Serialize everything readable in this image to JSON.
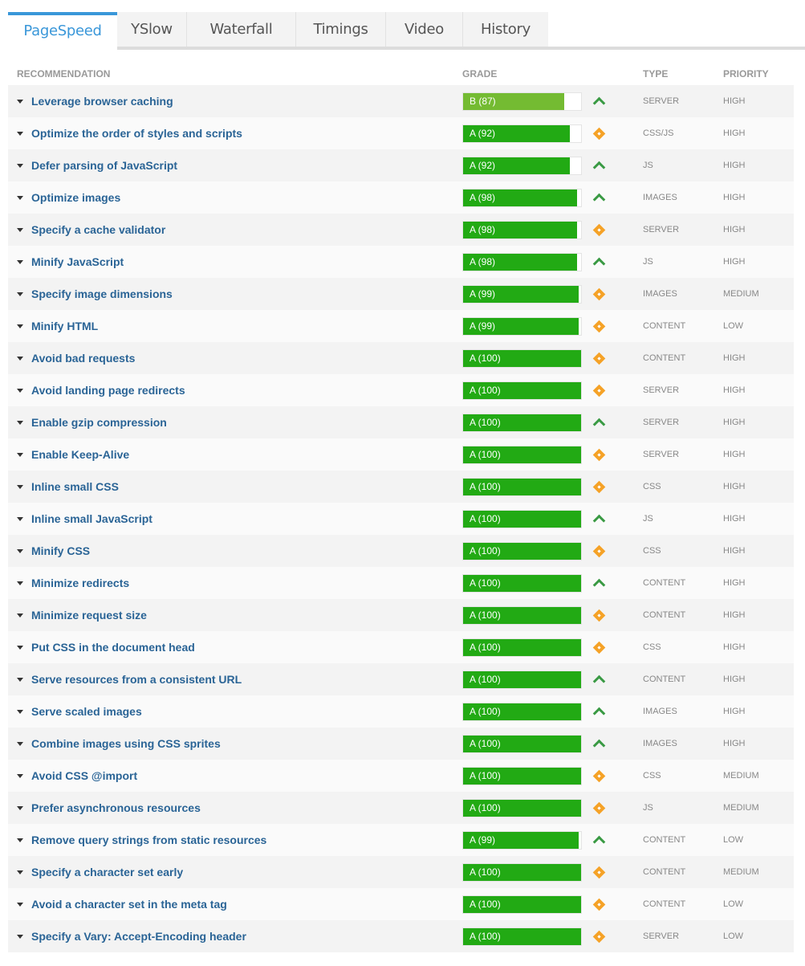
{
  "tabs": [
    {
      "label": "PageSpeed",
      "active": true
    },
    {
      "label": "YSlow",
      "active": false
    },
    {
      "label": "Waterfall",
      "active": false
    },
    {
      "label": "Timings",
      "active": false
    },
    {
      "label": "Video",
      "active": false
    },
    {
      "label": "History",
      "active": false
    }
  ],
  "colors": {
    "accent": "#3a97d9",
    "grade_a": "#22aa14",
    "grade_b": "#74bb32",
    "trend_up": "#3a9a44",
    "trend_neutral": "#f5a227",
    "link": "#2a6496"
  },
  "table": {
    "headers": {
      "recommendation": "RECOMMENDATION",
      "grade": "GRADE",
      "type": "TYPE",
      "priority": "PRIORITY"
    },
    "rows": [
      {
        "name": "Leverage browser caching",
        "grade": "B",
        "score": 87,
        "grade_label": "B (87)",
        "trend": "up",
        "type": "SERVER",
        "priority": "HIGH"
      },
      {
        "name": "Optimize the order of styles and scripts",
        "grade": "A",
        "score": 92,
        "grade_label": "A (92)",
        "trend": "neutral",
        "type": "CSS/JS",
        "priority": "HIGH"
      },
      {
        "name": "Defer parsing of JavaScript",
        "grade": "A",
        "score": 92,
        "grade_label": "A (92)",
        "trend": "up",
        "type": "JS",
        "priority": "HIGH"
      },
      {
        "name": "Optimize images",
        "grade": "A",
        "score": 98,
        "grade_label": "A (98)",
        "trend": "up",
        "type": "IMAGES",
        "priority": "HIGH"
      },
      {
        "name": "Specify a cache validator",
        "grade": "A",
        "score": 98,
        "grade_label": "A (98)",
        "trend": "neutral",
        "type": "SERVER",
        "priority": "HIGH"
      },
      {
        "name": "Minify JavaScript",
        "grade": "A",
        "score": 98,
        "grade_label": "A (98)",
        "trend": "up",
        "type": "JS",
        "priority": "HIGH"
      },
      {
        "name": "Specify image dimensions",
        "grade": "A",
        "score": 99,
        "grade_label": "A (99)",
        "trend": "neutral",
        "type": "IMAGES",
        "priority": "MEDIUM"
      },
      {
        "name": "Minify HTML",
        "grade": "A",
        "score": 99,
        "grade_label": "A (99)",
        "trend": "neutral",
        "type": "CONTENT",
        "priority": "LOW"
      },
      {
        "name": "Avoid bad requests",
        "grade": "A",
        "score": 100,
        "grade_label": "A (100)",
        "trend": "neutral",
        "type": "CONTENT",
        "priority": "HIGH"
      },
      {
        "name": "Avoid landing page redirects",
        "grade": "A",
        "score": 100,
        "grade_label": "A (100)",
        "trend": "neutral",
        "type": "SERVER",
        "priority": "HIGH"
      },
      {
        "name": "Enable gzip compression",
        "grade": "A",
        "score": 100,
        "grade_label": "A (100)",
        "trend": "up",
        "type": "SERVER",
        "priority": "HIGH"
      },
      {
        "name": "Enable Keep-Alive",
        "grade": "A",
        "score": 100,
        "grade_label": "A (100)",
        "trend": "neutral",
        "type": "SERVER",
        "priority": "HIGH"
      },
      {
        "name": "Inline small CSS",
        "grade": "A",
        "score": 100,
        "grade_label": "A (100)",
        "trend": "neutral",
        "type": "CSS",
        "priority": "HIGH"
      },
      {
        "name": "Inline small JavaScript",
        "grade": "A",
        "score": 100,
        "grade_label": "A (100)",
        "trend": "up",
        "type": "JS",
        "priority": "HIGH"
      },
      {
        "name": "Minify CSS",
        "grade": "A",
        "score": 100,
        "grade_label": "A (100)",
        "trend": "neutral",
        "type": "CSS",
        "priority": "HIGH"
      },
      {
        "name": "Minimize redirects",
        "grade": "A",
        "score": 100,
        "grade_label": "A (100)",
        "trend": "up",
        "type": "CONTENT",
        "priority": "HIGH"
      },
      {
        "name": "Minimize request size",
        "grade": "A",
        "score": 100,
        "grade_label": "A (100)",
        "trend": "neutral",
        "type": "CONTENT",
        "priority": "HIGH"
      },
      {
        "name": "Put CSS in the document head",
        "grade": "A",
        "score": 100,
        "grade_label": "A (100)",
        "trend": "neutral",
        "type": "CSS",
        "priority": "HIGH"
      },
      {
        "name": "Serve resources from a consistent URL",
        "grade": "A",
        "score": 100,
        "grade_label": "A (100)",
        "trend": "up",
        "type": "CONTENT",
        "priority": "HIGH"
      },
      {
        "name": "Serve scaled images",
        "grade": "A",
        "score": 100,
        "grade_label": "A (100)",
        "trend": "up",
        "type": "IMAGES",
        "priority": "HIGH"
      },
      {
        "name": "Combine images using CSS sprites",
        "grade": "A",
        "score": 100,
        "grade_label": "A (100)",
        "trend": "up",
        "type": "IMAGES",
        "priority": "HIGH"
      },
      {
        "name": "Avoid CSS @import",
        "grade": "A",
        "score": 100,
        "grade_label": "A (100)",
        "trend": "neutral",
        "type": "CSS",
        "priority": "MEDIUM"
      },
      {
        "name": "Prefer asynchronous resources",
        "grade": "A",
        "score": 100,
        "grade_label": "A (100)",
        "trend": "neutral",
        "type": "JS",
        "priority": "MEDIUM"
      },
      {
        "name": "Remove query strings from static resources",
        "grade": "A",
        "score": 99,
        "grade_label": "A (99)",
        "trend": "up",
        "type": "CONTENT",
        "priority": "LOW"
      },
      {
        "name": "Specify a character set early",
        "grade": "A",
        "score": 100,
        "grade_label": "A (100)",
        "trend": "neutral",
        "type": "CONTENT",
        "priority": "MEDIUM"
      },
      {
        "name": "Avoid a character set in the meta tag",
        "grade": "A",
        "score": 100,
        "grade_label": "A (100)",
        "trend": "neutral",
        "type": "CONTENT",
        "priority": "LOW"
      },
      {
        "name": "Specify a Vary: Accept-Encoding header",
        "grade": "A",
        "score": 100,
        "grade_label": "A (100)",
        "trend": "neutral",
        "type": "SERVER",
        "priority": "LOW"
      }
    ]
  }
}
